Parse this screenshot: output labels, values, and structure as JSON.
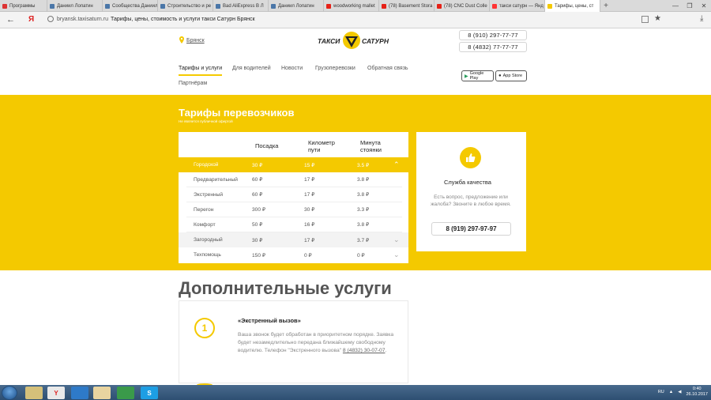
{
  "browser": {
    "tabs": [
      {
        "title": "Программы",
        "color": "#d33"
      },
      {
        "title": "Даниил Лопатин",
        "color": "#4a76a8"
      },
      {
        "title": "Сообщества Даниил",
        "color": "#4a76a8"
      },
      {
        "title": "Строительство и ре",
        "color": "#4a76a8"
      },
      {
        "title": "Bad AliExpress В Л",
        "color": "#4a76a8"
      },
      {
        "title": "Даниил Лопатин",
        "color": "#4a76a8"
      },
      {
        "title": "woodworking mallet",
        "color": "#e62117"
      },
      {
        "title": "(78) Basement Stora",
        "color": "#e62117"
      },
      {
        "title": "(78) CNC Dust Colle",
        "color": "#e62117"
      },
      {
        "title": "такси сатурн — Янд",
        "color": "#f33"
      },
      {
        "title": "Тарифы, цены, ст",
        "color": "#f4c900"
      }
    ],
    "url_host": "bryansk.taxisaturn.ru",
    "page_title": "Тарифы, цены, стоимость и услуги такси Сатурн Брянск",
    "yandex_glyph": "Я"
  },
  "site": {
    "city": "Брянск",
    "logo_left": "ТАКСИ",
    "logo_right": "САТУРН",
    "phones": [
      "8 (910) 297-77-77",
      "8 (4832) 77-77-77"
    ],
    "nav": [
      "Тарифы и услуги",
      "Для водителей",
      "Новости",
      "Грузоперевозки",
      "Обратная связь"
    ],
    "nav_sub": "Партнёрам",
    "google_play": "Google Play",
    "app_store": "App Store"
  },
  "tariffs": {
    "title": "Тарифы перевозчиков",
    "subtitle": "Не является публичной офертой",
    "headers": [
      "Посадка",
      "Километр пути",
      "Минута стоянки"
    ],
    "rows": [
      {
        "name": "Городской",
        "a": "30 ₽",
        "b": "15 ₽",
        "c": "3.5 ₽",
        "style": "sel",
        "chev": "⌃"
      },
      {
        "name": "Предварительный",
        "a": "60 ₽",
        "b": "17 ₽",
        "c": "3.8 ₽",
        "style": "sub",
        "chev": ""
      },
      {
        "name": "Экстренный",
        "a": "60 ₽",
        "b": "17 ₽",
        "c": "3.8 ₽",
        "style": "sub",
        "chev": ""
      },
      {
        "name": "Перегон",
        "a": "300 ₽",
        "b": "30 ₽",
        "c": "3.3 ₽",
        "style": "sub",
        "chev": ""
      },
      {
        "name": "Комфорт",
        "a": "50 ₽",
        "b": "16 ₽",
        "c": "3.8 ₽",
        "style": "sub",
        "chev": ""
      },
      {
        "name": "Загородный",
        "a": "30 ₽",
        "b": "17 ₽",
        "c": "3.7 ₽",
        "style": "gray",
        "chev": "⌄"
      },
      {
        "name": "Техпомощь",
        "a": "150 ₽",
        "b": "0 ₽",
        "c": "0 ₽",
        "style": "plain",
        "chev": "⌄"
      }
    ]
  },
  "quality": {
    "title": "Служба качества",
    "text": "Есть вопрос, предложение или жалоба? Звоните в любое время.",
    "phone": "8 (919) 297-97-97"
  },
  "services": {
    "title": "Дополнительные услуги",
    "item": {
      "number": "1",
      "title": "«Экстренный вызов»",
      "text": "Ваша звонок будет обработан в приоритетном порядке. Заявка будет незамедлительно передана ближайшему свободному водителю. Телефон \"Экстренного вызова\"",
      "phone": "8 (4832) 30-07-07",
      "end": "."
    }
  },
  "taskbar": {
    "lang": "RU",
    "time": "0:40",
    "date": "26.10.2017"
  }
}
